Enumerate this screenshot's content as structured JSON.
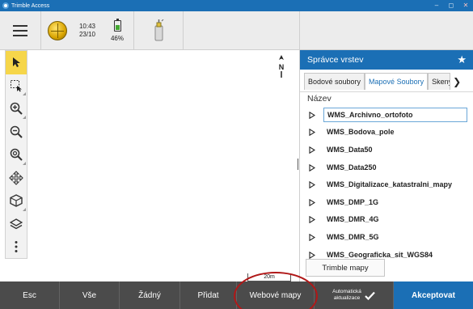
{
  "window": {
    "title": "Trimble Access",
    "controls": [
      "–",
      "◻",
      "✕"
    ]
  },
  "status": {
    "time": "10:43",
    "date": "23/10",
    "battery_percent": "46%",
    "battery_level": 0.46
  },
  "map": {
    "north_label": "N",
    "scale_label": "20m"
  },
  "panel": {
    "title": "Správce vrstev",
    "tabs": [
      {
        "label": "Bodové soubory"
      },
      {
        "label": "Mapové Soubory"
      },
      {
        "label": "Skeny"
      }
    ],
    "column_header": "Název",
    "items": [
      "WMS_Archivno_ortofoto",
      "WMS_Bodova_pole",
      "WMS_Data50",
      "WMS_Data250",
      "WMS_Digitalizace_katastralni_mapy",
      "WMS_DMP_1G",
      "WMS_DMR_4G",
      "WMS_DMR_5G",
      "WMS_Geograficka_sit_WGS84"
    ],
    "selected_index": 0,
    "trimble_maps_label": "Trimble mapy"
  },
  "bottom": {
    "esc": "Esc",
    "all": "Vše",
    "none": "Žádný",
    "add": "Přidat",
    "web_maps": "Webové mapy",
    "auto_update_line1": "Automatická",
    "auto_update_line2": "aktualizace",
    "accept": "Akceptovat"
  },
  "colors": {
    "accent": "#1b6fb5",
    "active_tool": "#f6d64a",
    "bottom_bar": "#4b4b4b",
    "callout": "#b01818"
  }
}
